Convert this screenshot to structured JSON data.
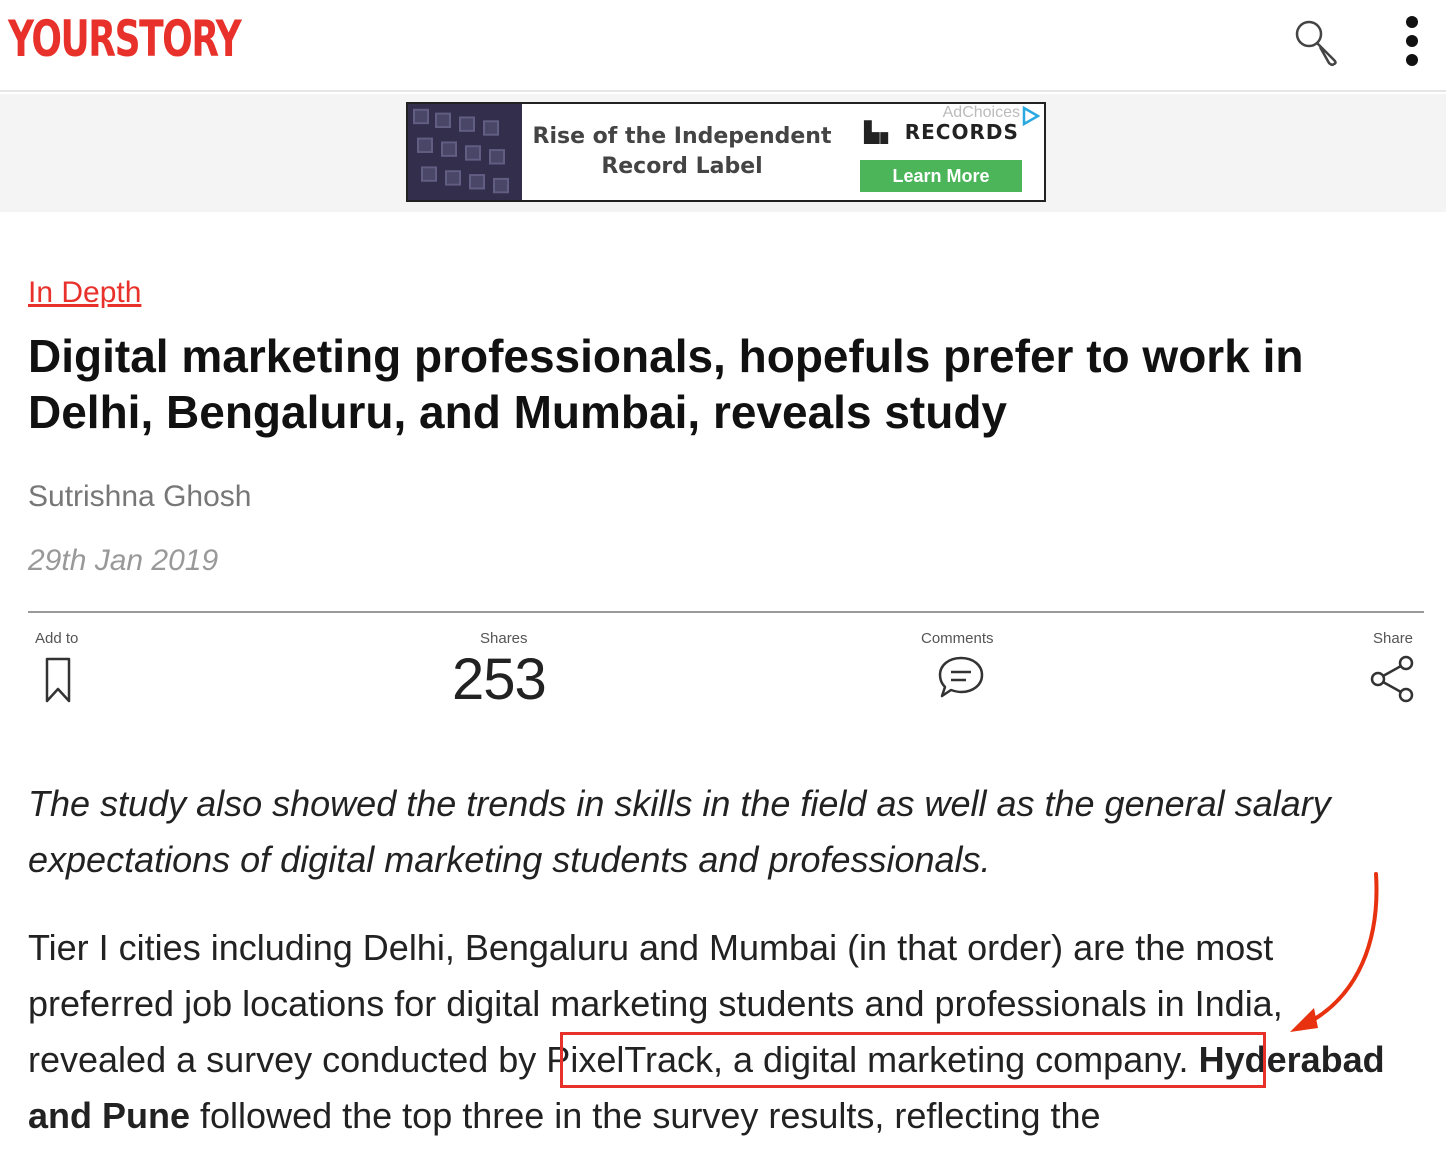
{
  "header": {
    "logo": "YOURSTORY",
    "search_icon": "search-icon",
    "menu_icon": "more-vert-icon"
  },
  "ad": {
    "headline": "Rise of the Independent Record Label",
    "brand": "RECORDS",
    "choices": "AdChoices",
    "cta": "Learn More"
  },
  "article": {
    "category": "In Depth",
    "title": "Digital marketing professionals, hopefuls prefer to work in Delhi, Bengaluru, and Mumbai, reveals study",
    "author": "Sutrishna Ghosh",
    "date": "29th Jan 2019",
    "actions": {
      "add_to_label": "Add to",
      "shares_label": "Shares",
      "shares_count": "253",
      "comments_label": "Comments",
      "share_label": "Share"
    },
    "summary": "The study also showed the trends in skills in the field as well as the general salary expectations of digital marketing students and professionals.",
    "body_part1": "Tier I cities including Delhi, Bengaluru and Mumbai (in that order) are the most preferred job locations for digital marketing students and professionals in India, revealed a survey conducted by PixelTrack, a digital marketing company.",
    "body_bold": "Hyderabad and Pune",
    "body_part2": " followed the top three in the survey results, reflecting the"
  },
  "colors": {
    "brand_red": "#e8312a",
    "cta_green": "#4cb55a"
  }
}
